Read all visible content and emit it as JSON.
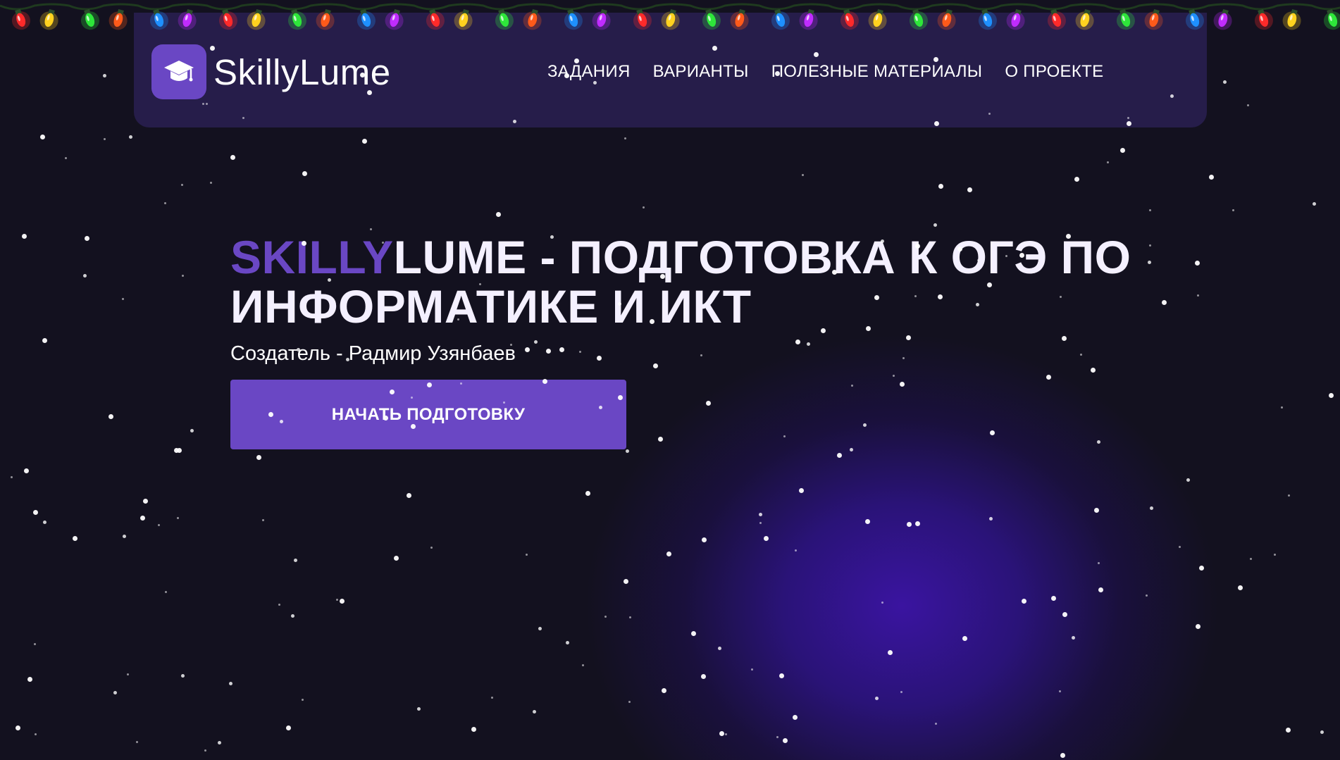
{
  "header": {
    "logo_text": "SkillyLume",
    "logo_icon": "graduation-cap-icon",
    "nav": [
      {
        "label": "ЗАДАНИЯ"
      },
      {
        "label": "ВАРИАНТЫ"
      },
      {
        "label": "ПОЛЕЗНЫЕ МАТЕРИАЛЫ"
      },
      {
        "label": "О ПРОЕКТЕ"
      }
    ]
  },
  "hero": {
    "title_accent": "SKILLY",
    "title_rest": "LUME - ПОДГОТОВКА К ОГЭ ПО ИНФОРМАТИКЕ И ИКТ",
    "subtitle": "Создатель - Радмир Узянбаев",
    "cta_label": "НАЧАТЬ ПОДГОТОВКУ"
  },
  "decor": {
    "garland_icon": "christmas-lights-icon",
    "snow_icon": "snowflake-icon",
    "bulb_colors": [
      "#ff2a2a",
      "#ffd21f",
      "#2ee63a",
      "#ff5a1a",
      "#1e90ff",
      "#c02cff"
    ]
  },
  "colors": {
    "accent": "#6a47c4",
    "background": "#13111f",
    "glow": "#3a14a0"
  }
}
